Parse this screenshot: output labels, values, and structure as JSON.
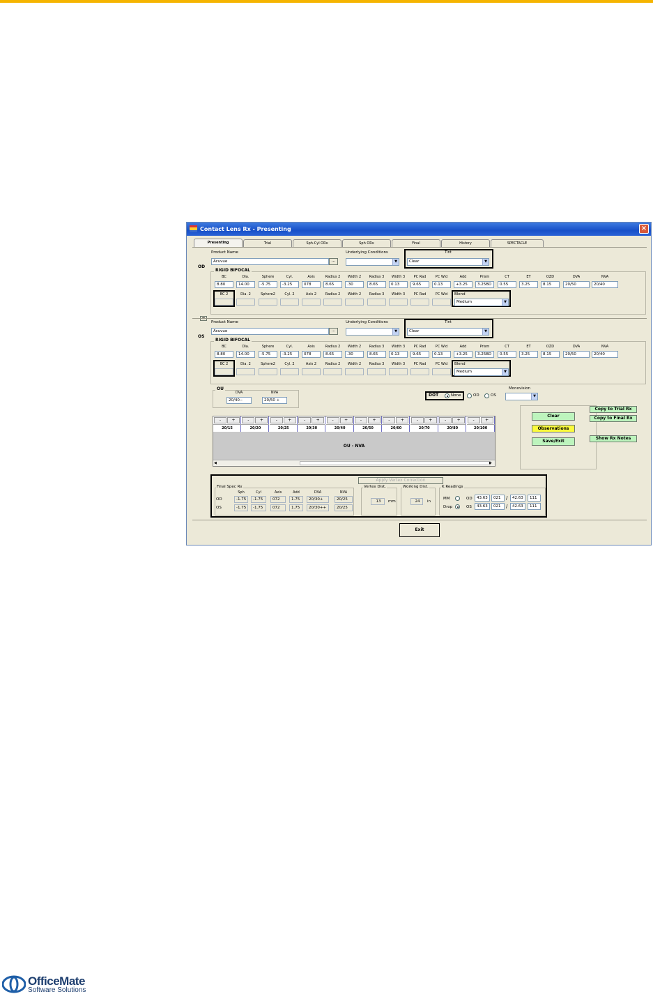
{
  "window": {
    "title": "Contact Lens Rx - Presenting",
    "close": "×"
  },
  "tabs": [
    "Presenting",
    "Trial",
    "Sph-Cyl ORx",
    "Sph ORx",
    "Final",
    "History",
    "SPECTACLE"
  ],
  "eye_labels": {
    "od": "OD",
    "os": "OS"
  },
  "labels": {
    "product_name": "Product Name",
    "underlying": "Underlying Conditions",
    "tint": "Tint",
    "rigid": "RIGID BIFOCAL",
    "blend": "Blend",
    "ellipsis": "...",
    "collapse": "="
  },
  "cols1": [
    "BC",
    "Dia.",
    "Sphere",
    "Cyl.",
    "Axis",
    "Radius 2",
    "Width 2",
    "Radius 3",
    "Width 3",
    "PC Rad",
    "PC Wid",
    "Add",
    "Prism",
    "CT",
    "ET",
    "OZD",
    "DVA",
    "NVA"
  ],
  "cols2": [
    "BC 2",
    "Dia. 2",
    "Sphere2",
    "Cyl. 2",
    "Axis 2",
    "Radius 2",
    "Width 2",
    "Radius 3",
    "Width 3",
    "PC Rad",
    "PC Wid"
  ],
  "od": {
    "product": "Acuvue",
    "underlying": "",
    "tint": "Clear",
    "blend": "Medium",
    "values": [
      "8.80",
      "14.00",
      "-5.75",
      "-3.25",
      "078",
      "8.65",
      ".30",
      "8.65",
      "0.13",
      "9.65",
      "0.13",
      "+3.25",
      "3.25BD",
      "0.55",
      "3.25",
      "8.15",
      "20/50",
      "20/40"
    ]
  },
  "os": {
    "product": "Acuvue",
    "underlying": "",
    "tint": "Clear",
    "blend": "Medium",
    "values": [
      "8.80",
      "14.00",
      "-5.75",
      "-3.25",
      "078",
      "8.65",
      ".30",
      "8.65",
      "0.13",
      "9.65",
      "0.13",
      "+3.25",
      "3.25BD",
      "0.55",
      "3.25",
      "8.15",
      "20/50",
      "20/40"
    ]
  },
  "ou": {
    "title": "OU",
    "dva_label": "DVA",
    "nva_label": "NVA",
    "dva": "20/40--",
    "nva": "20/50 +"
  },
  "dot": {
    "label": "DOT",
    "options": [
      "None",
      "OD",
      "OS"
    ],
    "selected": "None"
  },
  "monovision": {
    "label": "Monovision",
    "value": ""
  },
  "buttons": {
    "clear": "Clear",
    "observations": "Observations",
    "save_exit": "Save/Exit",
    "copy_trial": "Copy to Trial Rx",
    "copy_final": "Copy to Final Rx",
    "show_notes": "Show Rx Notes",
    "exit": "Exit",
    "minus": "-",
    "plus": "+"
  },
  "acuity": {
    "labels": [
      "20/15",
      "20/20",
      "20/25",
      "20/30",
      "20/40",
      "20/50",
      "20/60",
      "20/70",
      "20/80",
      "20/100"
    ],
    "area_text": "OU - NVA"
  },
  "final_spec": {
    "title": "Final Spec Rx",
    "headers": [
      "Sph",
      "Cyl",
      "Axis",
      "Add",
      "DVA",
      "NVA"
    ],
    "rows": [
      {
        "eye": "OD",
        "values": [
          "-1.75",
          "-1.75",
          "072",
          "1.75",
          "20/30+",
          "20/25"
        ]
      },
      {
        "eye": "OS",
        "values": [
          "-1.75",
          "-1.75",
          "072",
          "1.75",
          "20/30++",
          "20/25"
        ]
      }
    ]
  },
  "vertex": {
    "button": "Apply Vertex Correction",
    "title": "Vertex Dist.",
    "value": "13",
    "unit": "mm",
    "wd_title": "Working Dist.",
    "wd_value": "24",
    "wd_unit": "in"
  },
  "k": {
    "title": "K Readings",
    "mm": "MM",
    "drop": "Drop",
    "od": "OD",
    "os": "OS",
    "slash": "/",
    "od_vals": [
      "43.63",
      "021",
      "42.63",
      "111"
    ],
    "os_vals": [
      "43.63",
      "021",
      "42.63",
      "111"
    ]
  },
  "logo": {
    "name": "OfficeMate",
    "tagline": "Software Solutions"
  }
}
